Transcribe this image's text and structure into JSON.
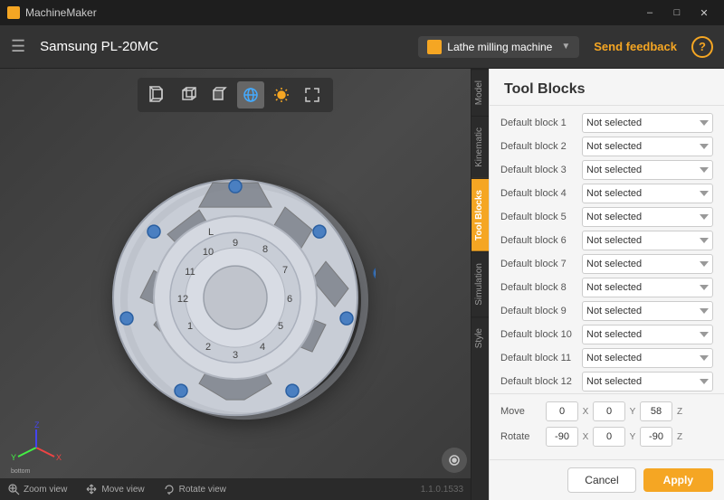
{
  "titlebar": {
    "app_name": "MachineMaker",
    "controls": [
      "minimize",
      "maximize",
      "close"
    ]
  },
  "header": {
    "title": "Samsung PL-20MC",
    "machine_type": "Lathe milling machine",
    "send_feedback": "Send feedback",
    "help": "?"
  },
  "toolbar": {
    "tools": [
      {
        "name": "perspective-view",
        "icon": "cube-perspective"
      },
      {
        "name": "front-view",
        "icon": "cube-front"
      },
      {
        "name": "top-view",
        "icon": "cube-top"
      },
      {
        "name": "rotate-view",
        "icon": "globe"
      },
      {
        "name": "highlight-view",
        "icon": "sun"
      },
      {
        "name": "fit-view",
        "icon": "expand"
      }
    ]
  },
  "tabs": [
    {
      "id": "model",
      "label": "Model",
      "active": false
    },
    {
      "id": "kinematic",
      "label": "Kinematic",
      "active": false
    },
    {
      "id": "tool-blocks",
      "label": "Tool Blocks",
      "active": true
    },
    {
      "id": "simulation",
      "label": "Simulation",
      "active": false
    },
    {
      "id": "style",
      "label": "Style",
      "active": false
    }
  ],
  "panel": {
    "title": "Tool Blocks",
    "blocks": [
      {
        "label": "Default block 1",
        "value": "Not selected"
      },
      {
        "label": "Default block 2",
        "value": "Not selected"
      },
      {
        "label": "Default block 3",
        "value": "Not selected"
      },
      {
        "label": "Default block 4",
        "value": "Not selected"
      },
      {
        "label": "Default block 5",
        "value": "Not selected"
      },
      {
        "label": "Default block 6",
        "value": "Not selected"
      },
      {
        "label": "Default block 7",
        "value": "Not selected"
      },
      {
        "label": "Default block 8",
        "value": "Not selected"
      },
      {
        "label": "Default block 9",
        "value": "Not selected"
      },
      {
        "label": "Default block 10",
        "value": "Not selected"
      },
      {
        "label": "Default block 11",
        "value": "Not selected"
      },
      {
        "label": "Default block 12",
        "value": "Not selected"
      }
    ],
    "move": {
      "label": "Move",
      "x": "0",
      "y": "0",
      "z": "58"
    },
    "rotate": {
      "label": "Rotate",
      "x": "-90",
      "y": "0",
      "z": "-90"
    },
    "cancel_label": "Cancel",
    "apply_label": "Apply"
  },
  "viewport": {
    "zoom_label": "Zoom view",
    "move_label": "Move view",
    "rotate_label": "Rotate view",
    "version": "1.1.0.1533"
  }
}
